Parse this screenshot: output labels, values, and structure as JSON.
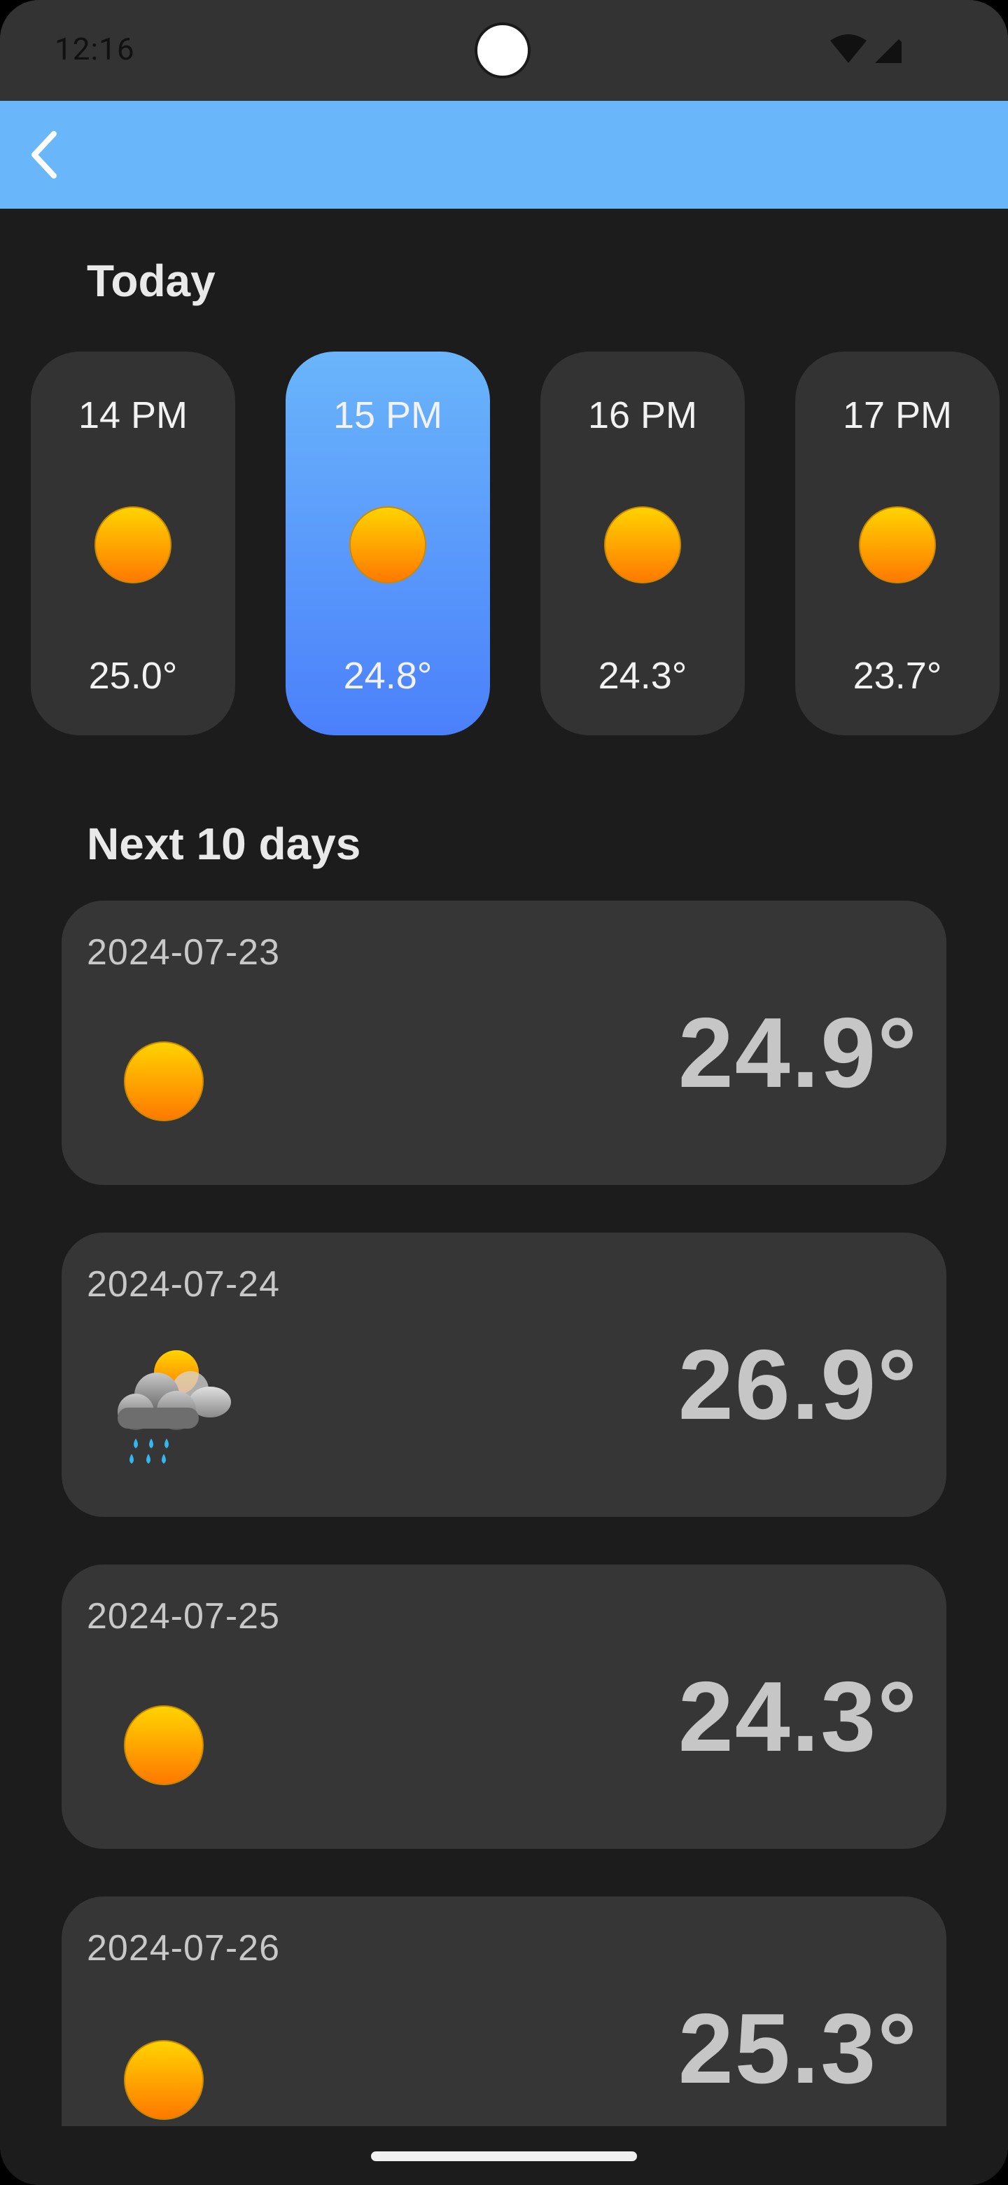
{
  "status_bar": {
    "time": "12:16",
    "icons": [
      "wifi-icon",
      "signal-icon"
    ]
  },
  "app_bar": {
    "back_icon": "chevron-left-icon",
    "accent": "#69b6fb"
  },
  "today": {
    "title": "Today",
    "hours": [
      {
        "label": "14 PM",
        "icon": "sun-icon",
        "temp": "25.0°",
        "selected": false
      },
      {
        "label": "15 PM",
        "icon": "sun-icon",
        "temp": "24.8°",
        "selected": true
      },
      {
        "label": "16 PM",
        "icon": "sun-icon",
        "temp": "24.3°",
        "selected": false
      },
      {
        "label": "17 PM",
        "icon": "sun-icon",
        "temp": "23.7°",
        "selected": false
      }
    ]
  },
  "next_days": {
    "title": "Next 10 days",
    "days": [
      {
        "date": "2024-07-23",
        "icon": "sun-icon",
        "temp": "24.9°"
      },
      {
        "date": "2024-07-24",
        "icon": "sun-cloud-rain-icon",
        "temp": "26.9°"
      },
      {
        "date": "2024-07-25",
        "icon": "sun-icon",
        "temp": "24.3°"
      },
      {
        "date": "2024-07-26",
        "icon": "sun-icon",
        "temp": "25.3°"
      }
    ]
  },
  "colors": {
    "background": "#1c1c1c",
    "card": "#333333",
    "selected_gradient_top": "#6ab5fb",
    "selected_gradient_bottom": "#4b80fb",
    "sun_top": "#ffd200",
    "sun_bottom": "#ff7a00"
  }
}
